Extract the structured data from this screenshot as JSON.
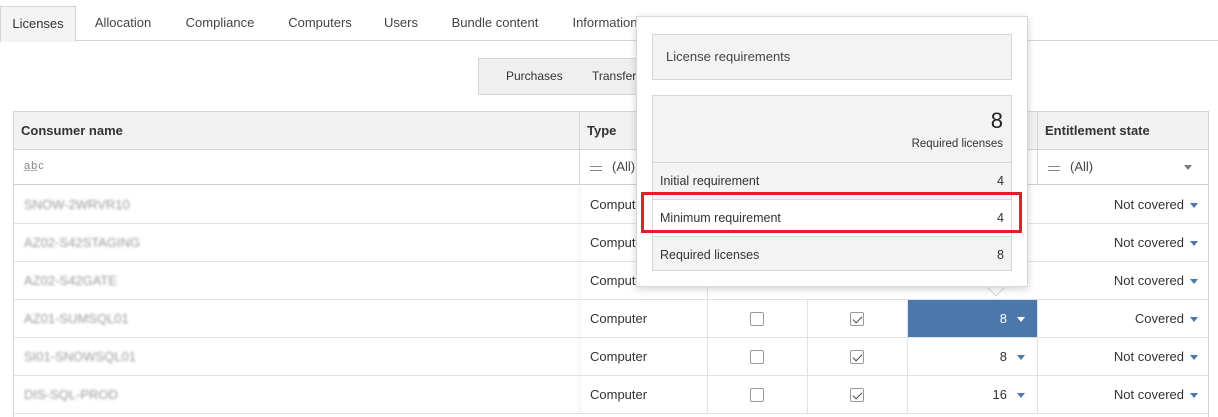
{
  "tabs": [
    {
      "label": "Licenses",
      "active": true
    },
    {
      "label": "Allocation"
    },
    {
      "label": "Compliance"
    },
    {
      "label": "Computers"
    },
    {
      "label": "Users"
    },
    {
      "label": "Bundle content"
    },
    {
      "label": "Information"
    }
  ],
  "subtabs": [
    "Purchases",
    "Transfer"
  ],
  "grid": {
    "headers": {
      "consumer": "Consumer name",
      "type": "Type",
      "entitlement": "Entitlement state"
    },
    "filters": {
      "consumer": "a̲b̲c",
      "type": "(All)",
      "entitlement": "(All)"
    },
    "rows": [
      {
        "consumer": "SNOW-2WRVR10",
        "type": "Computer",
        "entitlement": "Not covered"
      },
      {
        "consumer": "AZ02-S42STAGING",
        "type": "Computer",
        "entitlement": "Not covered"
      },
      {
        "consumer": "AZ02-S42GATE",
        "type": "Computer",
        "entitlement": "Not covered"
      },
      {
        "consumer": "AZ01-SUMSQL01",
        "type": "Computer",
        "check1": false,
        "check2": true,
        "required": "8",
        "entitlement": "Covered",
        "selected": true
      },
      {
        "consumer": "SI01-SNOWSQL01",
        "type": "Computer",
        "check1": false,
        "check2": true,
        "required": "8",
        "entitlement": "Not covered"
      },
      {
        "consumer": "DIS-SQL-PROD",
        "type": "Computer",
        "check1": false,
        "check2": true,
        "required": "16",
        "entitlement": "Not covered"
      }
    ]
  },
  "popover": {
    "title": "License requirements",
    "big_value": "8",
    "big_label": "Required licenses",
    "rows": [
      {
        "label": "Initial requirement",
        "value": "4"
      },
      {
        "label": "Minimum requirement",
        "value": "4"
      },
      {
        "label": "Required licenses",
        "value": "8"
      }
    ]
  },
  "colors": {
    "accent": "#4b77aa",
    "highlight": "#e0202b"
  }
}
